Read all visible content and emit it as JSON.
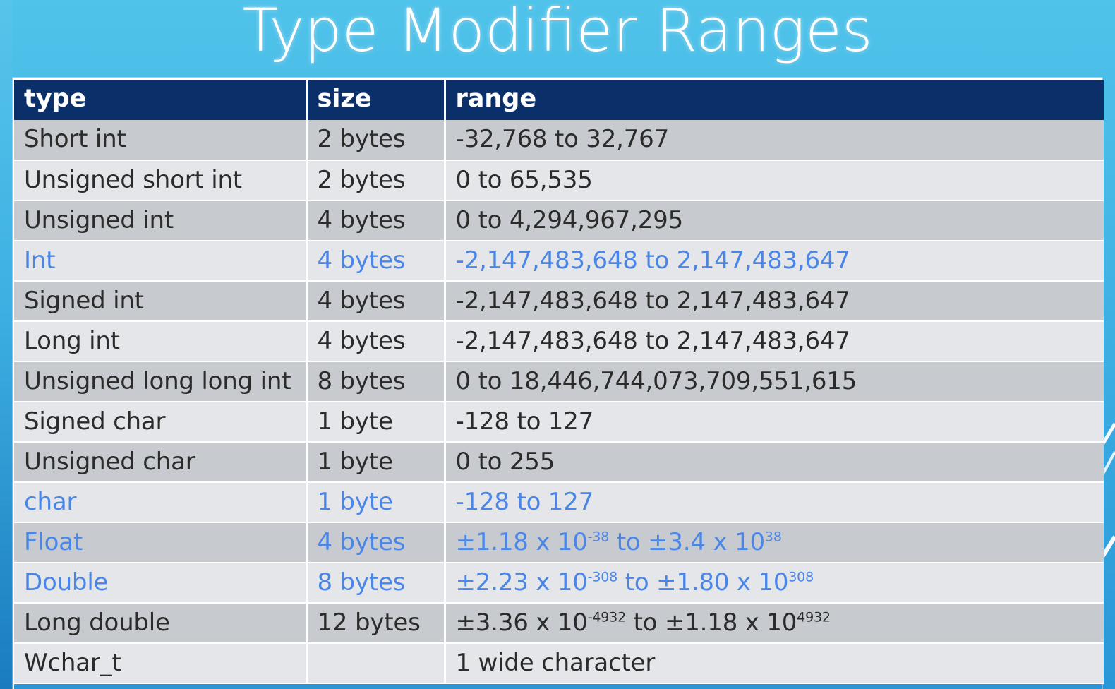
{
  "slide": {
    "title": "Type Modifier Ranges",
    "background_top_color": "#50C3EA",
    "background_bottom_color": "#2A96D6",
    "header_color": "#0B2F68",
    "highlight_color": "#4A86E8",
    "row_odd_color": "#C7CACE",
    "row_even_color": "#E4E6E9"
  },
  "table": {
    "columns": [
      "type",
      "size",
      "range"
    ],
    "rows": [
      {
        "type": "Short int",
        "size": "2 bytes",
        "range": "-32,768 to 32,767",
        "highlight": false
      },
      {
        "type": "Unsigned short int",
        "size": "2 bytes",
        "range": "0 to 65,535",
        "highlight": false
      },
      {
        "type": "Unsigned int",
        "size": "4 bytes",
        "range": "0 to 4,294,967,295",
        "highlight": false
      },
      {
        "type": "Int",
        "size": "4 bytes",
        "range": "-2,147,483,648 to 2,147,483,647",
        "highlight": true
      },
      {
        "type": "Signed int",
        "size": "4 bytes",
        "range": "-2,147,483,648 to 2,147,483,647",
        "highlight": false
      },
      {
        "type": "Long int",
        "size": "4 bytes",
        "range": "-2,147,483,648 to 2,147,483,647",
        "highlight": false
      },
      {
        "type": "Unsigned long long int",
        "size": "8 bytes",
        "range": "0 to 18,446,744,073,709,551,615",
        "highlight": false
      },
      {
        "type": "Signed char",
        "size": "1 byte",
        "range": "-128 to 127",
        "highlight": false
      },
      {
        "type": "Unsigned char",
        "size": "1 byte",
        "range": "0 to 255",
        "highlight": false
      },
      {
        "type": "char",
        "size": "1 byte",
        "range": "-128 to 127",
        "highlight": true
      },
      {
        "type": "Float",
        "size": "4 bytes",
        "range_html": "±1.18 x 10<sup>-38</sup> to ±3.4 x 10<sup>38</sup>",
        "range": "±1.18 x 10^-38 to ±3.4 x 10^38",
        "highlight": true
      },
      {
        "type": "Double",
        "size": "8 bytes",
        "range_html": "±2.23 x 10<sup>-308</sup> to ±1.80 x 10<sup>308</sup>",
        "range": "±2.23 x 10^-308 to ±1.80 x 10^308",
        "highlight": true
      },
      {
        "type": "Long double",
        "size": "12 bytes",
        "range_html": "±3.36 x 10<sup>-4932</sup> to ±1.18 x 10<sup>4932</sup>",
        "range": "±3.36 x 10^-4932 to ±1.18 x 10^4932",
        "highlight": false
      },
      {
        "type": "Wchar_t",
        "size": "",
        "range": "1 wide character",
        "highlight": false
      }
    ]
  }
}
